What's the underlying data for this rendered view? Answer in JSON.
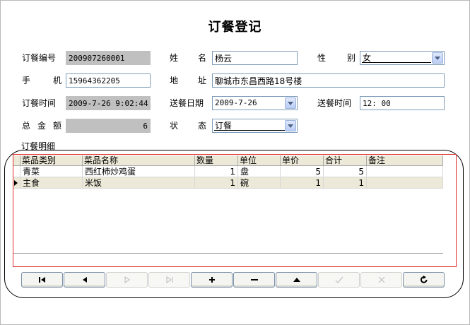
{
  "window": {
    "title": "订餐登记"
  },
  "form": {
    "order_no": {
      "label": "订餐编号",
      "value": "200907260001"
    },
    "name": {
      "label_a": "姓",
      "label_b": "名",
      "value": "杨云"
    },
    "gender": {
      "label_a": "性",
      "label_b": "别",
      "value": "女"
    },
    "phone": {
      "label_a": "手",
      "label_b": "机",
      "value": "15964362205"
    },
    "address": {
      "label_a": "地",
      "label_b": "址",
      "value": "聊城市东昌西路18号楼"
    },
    "order_time": {
      "label": "订餐时间",
      "value": "2009-7-26 9:02:44"
    },
    "delivery_date": {
      "label": "送餐日期",
      "value": "2009-7-26"
    },
    "delivery_time": {
      "label": "送餐时间",
      "value": "12: 00"
    },
    "total": {
      "label_a": "总",
      "label_b": "金",
      "label_c": "额",
      "value": "6"
    },
    "status": {
      "label_a": "状",
      "label_b": "态",
      "value": "订餐"
    }
  },
  "details": {
    "label": "订餐明细",
    "columns": [
      "菜品类别",
      "菜品名称",
      "数量",
      "单位",
      "单价",
      "合计",
      "备注"
    ],
    "rows": [
      {
        "category": "青菜",
        "dish": "西红柿炒鸡蛋",
        "qty": "1",
        "unit": "盘",
        "price": "5",
        "subtotal": "5",
        "remark": ""
      },
      {
        "category": "主食",
        "dish": "米饭",
        "qty": "1",
        "unit": "碗",
        "price": "1",
        "subtotal": "1",
        "remark": ""
      }
    ],
    "selected_row": 1
  },
  "navigator": {
    "buttons": [
      {
        "icon": "first-record-icon",
        "enabled": true
      },
      {
        "icon": "prior-record-icon",
        "enabled": true
      },
      {
        "icon": "next-record-icon",
        "enabled": false
      },
      {
        "icon": "last-record-icon",
        "enabled": false
      },
      {
        "icon": "insert-icon",
        "enabled": true
      },
      {
        "icon": "delete-icon",
        "enabled": true
      },
      {
        "icon": "edit-icon",
        "enabled": true
      },
      {
        "icon": "post-icon",
        "enabled": false
      },
      {
        "icon": "cancel-icon",
        "enabled": false
      },
      {
        "icon": "refresh-icon",
        "enabled": true
      }
    ]
  }
}
